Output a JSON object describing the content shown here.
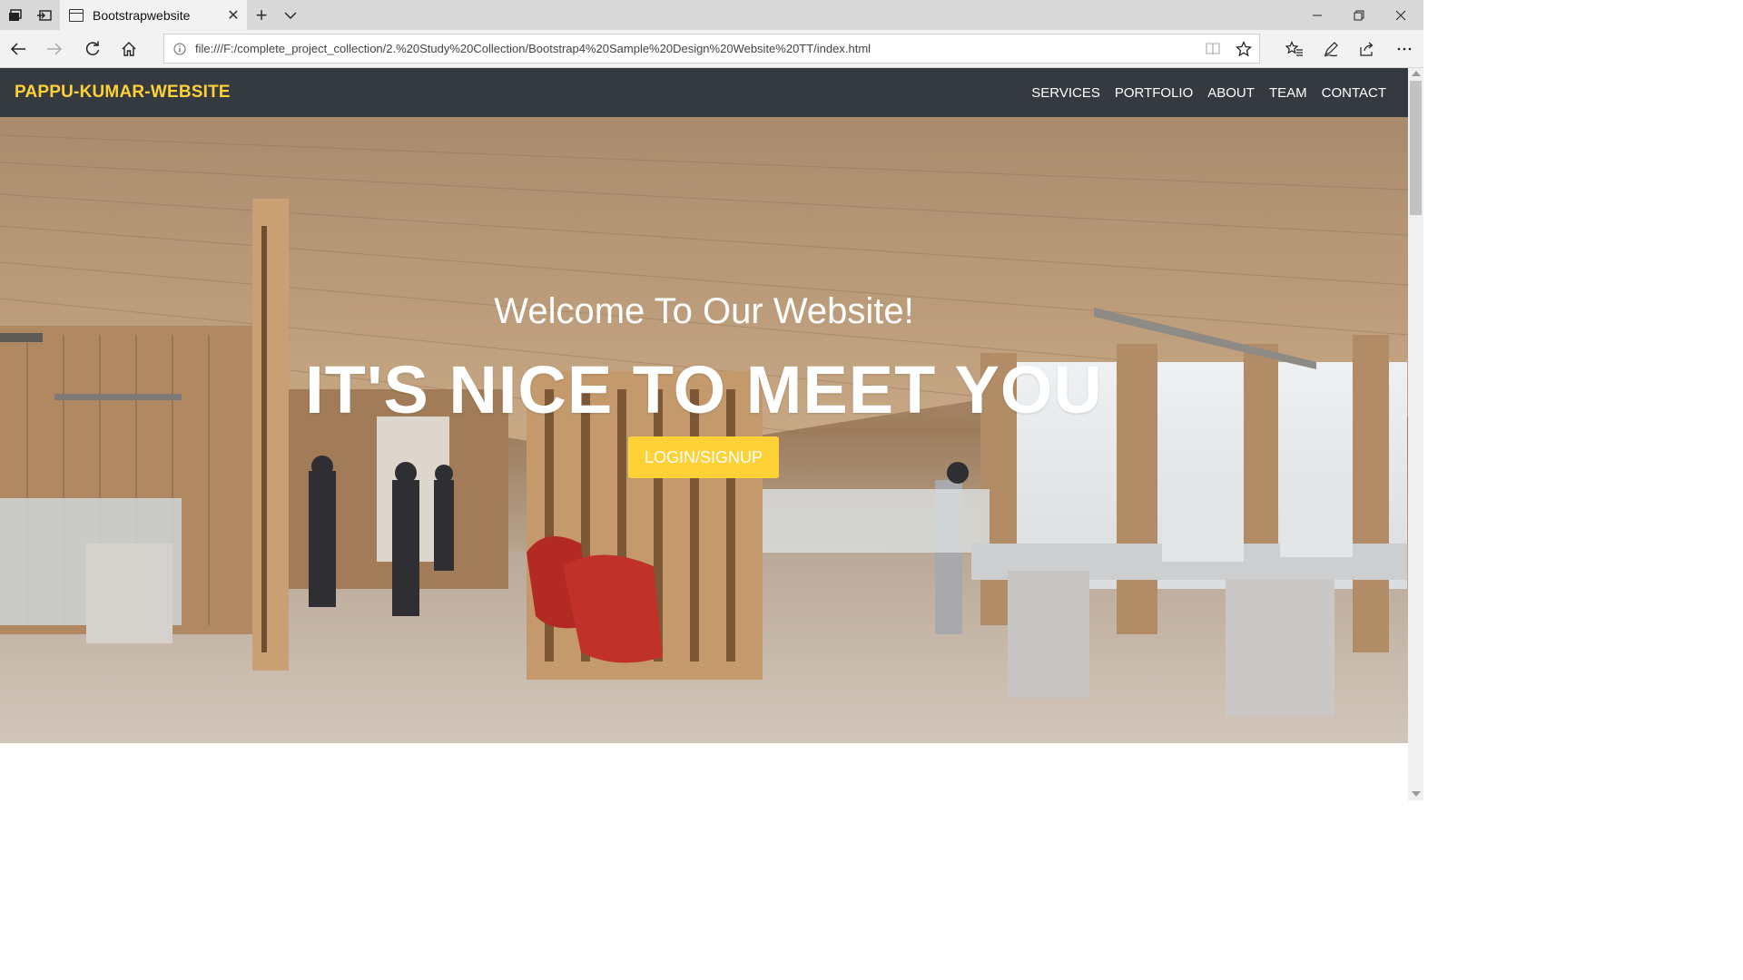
{
  "browser": {
    "tab_title": "Bootstrapwebsite",
    "url": "file:///F:/complete_project_collection/2.%20Study%20Collection/Bootstrap4%20Sample%20Design%20Website%20TT/index.html",
    "icons": [
      "tab-actions-icon",
      "set-aside-tabs-icon",
      "page-icon",
      "close-icon",
      "plus-icon",
      "chevron-down-icon",
      "minimize-icon",
      "restore-icon",
      "close-window-icon",
      "back-arrow-icon",
      "forward-arrow-icon",
      "refresh-icon",
      "home-icon",
      "info-icon",
      "reading-view-icon",
      "star-icon",
      "favorites-icon",
      "pen-icon",
      "share-icon",
      "more-icon"
    ]
  },
  "site": {
    "brand": "PAPPU-KUMAR-WEBSITE",
    "nav": [
      "SERVICES",
      "PORTFOLIO",
      "ABOUT",
      "TEAM",
      "CONTACT"
    ],
    "hero": {
      "subheading": "Welcome To Our Website!",
      "heading": "IT'S NICE TO MEET YOU",
      "button": "LOGIN/SIGNUP"
    },
    "colors": {
      "navbar": "#343a40",
      "accent": "#fed136",
      "text_light": "#ffffff"
    }
  }
}
